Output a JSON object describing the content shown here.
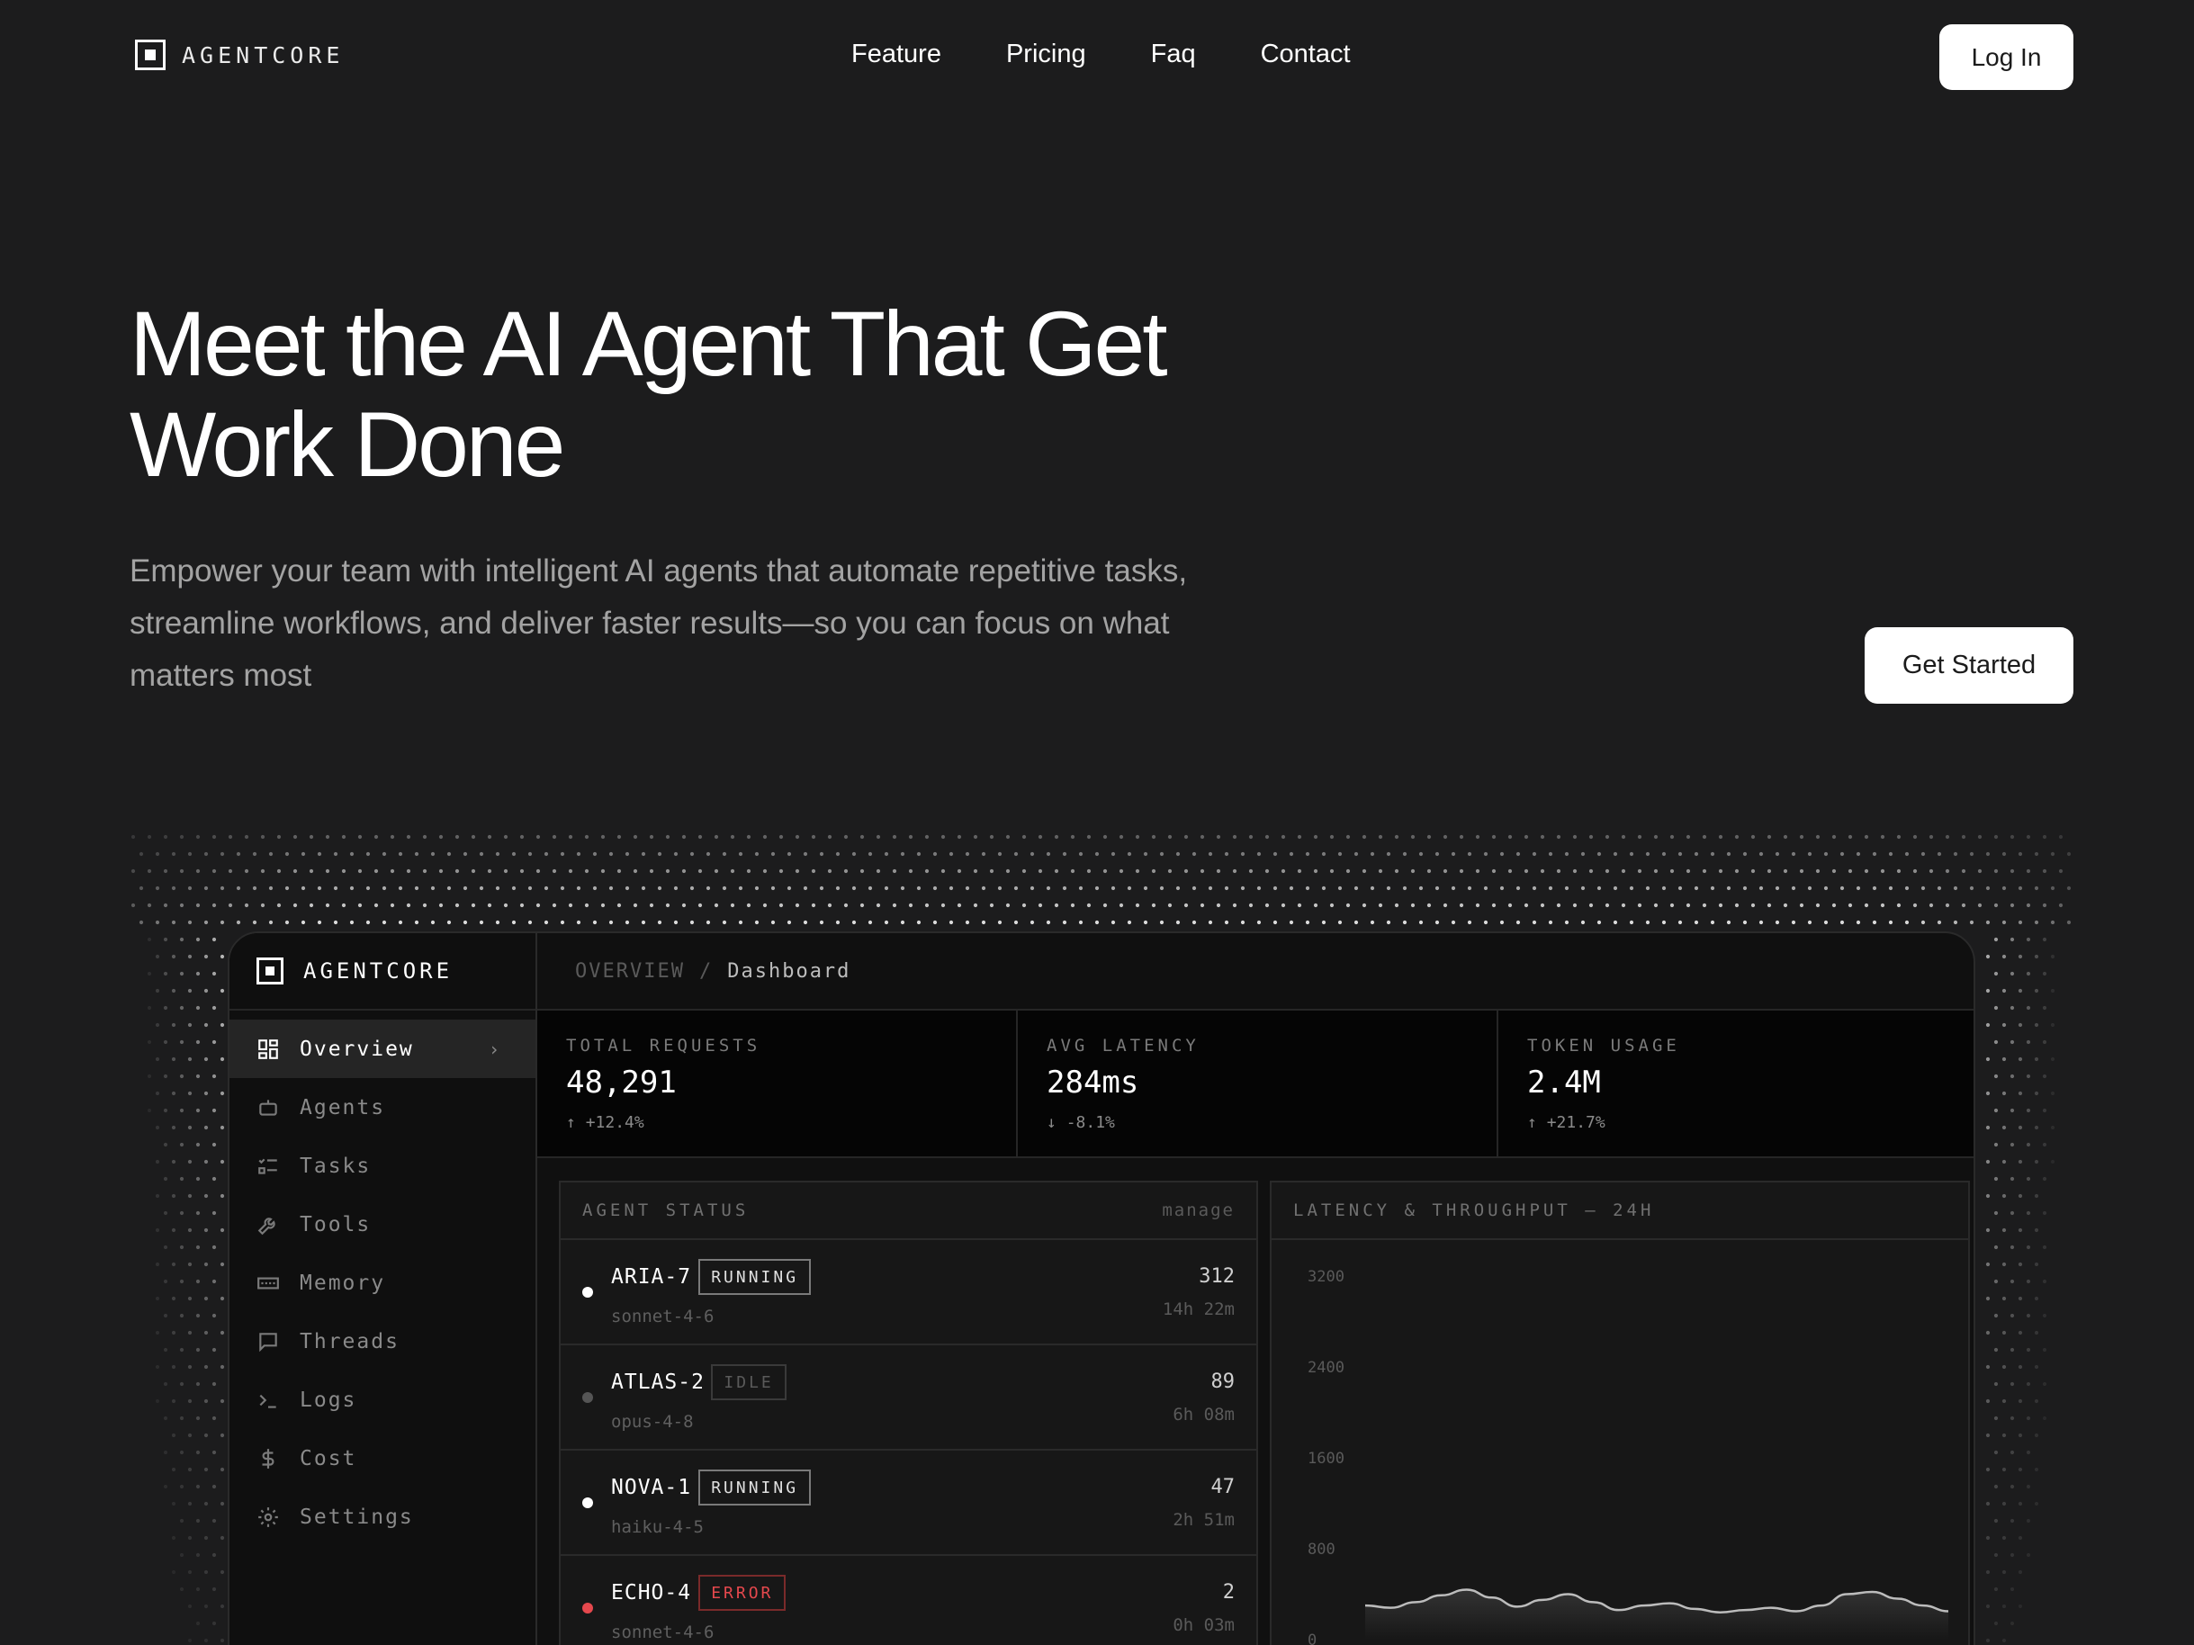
{
  "brand": {
    "name": "AGENTCORE"
  },
  "nav": {
    "links": [
      "Feature",
      "Pricing",
      "Faq",
      "Contact"
    ],
    "login_label": "Log In"
  },
  "hero": {
    "title_line1": "Meet the AI Agent That Get",
    "title_line2": "Work Done",
    "subtitle": "Empower your team with intelligent AI agents that automate repetitive tasks, streamline workflows, and deliver faster results—so you can focus on what matters most",
    "cta_label": "Get Started"
  },
  "app": {
    "brand": "AGENTCORE",
    "breadcrumb": {
      "section": "OVERVIEW",
      "separator": "/",
      "page": "Dashboard"
    },
    "sidebar": {
      "items": [
        {
          "label": "Overview",
          "icon": "grid-icon",
          "active": true
        },
        {
          "label": "Agents",
          "icon": "robot-icon"
        },
        {
          "label": "Tasks",
          "icon": "checklist-icon"
        },
        {
          "label": "Tools",
          "icon": "wrench-icon"
        },
        {
          "label": "Memory",
          "icon": "memory-chip-icon"
        },
        {
          "label": "Threads",
          "icon": "chat-bubble-icon"
        },
        {
          "label": "Logs",
          "icon": "terminal-icon"
        },
        {
          "label": "Cost",
          "icon": "dollar-icon"
        },
        {
          "label": "Settings",
          "icon": "gear-icon"
        }
      ],
      "chevron": "›"
    },
    "stats": [
      {
        "label": "TOTAL REQUESTS",
        "value": "48,291",
        "delta": "+12.4%",
        "trend": "up"
      },
      {
        "label": "AVG LATENCY",
        "value": "284ms",
        "delta": "-8.1%",
        "trend": "down"
      },
      {
        "label": "TOKEN USAGE",
        "value": "2.4M",
        "delta": "+21.7%",
        "trend": "up"
      }
    ],
    "agent_status": {
      "title": "AGENT STATUS",
      "action": "manage",
      "agents": [
        {
          "name": "ARIA-7",
          "status": "RUNNING",
          "model": "sonnet-4-6",
          "count": "312",
          "duration": "14h 22m",
          "status_color": "#ffffff"
        },
        {
          "name": "ATLAS-2",
          "status": "IDLE",
          "model": "opus-4-8",
          "count": "89",
          "duration": "6h 08m",
          "status_color": "#555555"
        },
        {
          "name": "NOVA-1",
          "status": "RUNNING",
          "model": "haiku-4-5",
          "count": "47",
          "duration": "2h 51m",
          "status_color": "#ffffff"
        },
        {
          "name": "ECHO-4",
          "status": "ERROR",
          "model": "sonnet-4-6",
          "count": "2",
          "duration": "0h 03m",
          "status_color": "#e5484d"
        }
      ]
    },
    "latency_chart": {
      "title": "LATENCY & THROUGHPUT — 24H",
      "y_ticks": [
        "3200",
        "2400",
        "1600",
        "800",
        "0"
      ]
    }
  },
  "chart_data": {
    "type": "area",
    "title": "LATENCY & THROUGHPUT — 24H",
    "ylim": [
      0,
      3200
    ],
    "y_ticks": [
      3200,
      2400,
      1600,
      800,
      0
    ],
    "series": [
      {
        "values": [
          300,
          280,
          330,
          390,
          440,
          370,
          290,
          350,
          400,
          330,
          260,
          300,
          320,
          270,
          240,
          260,
          280,
          250,
          300,
          400,
          420,
          360,
          300,
          250
        ]
      }
    ]
  }
}
